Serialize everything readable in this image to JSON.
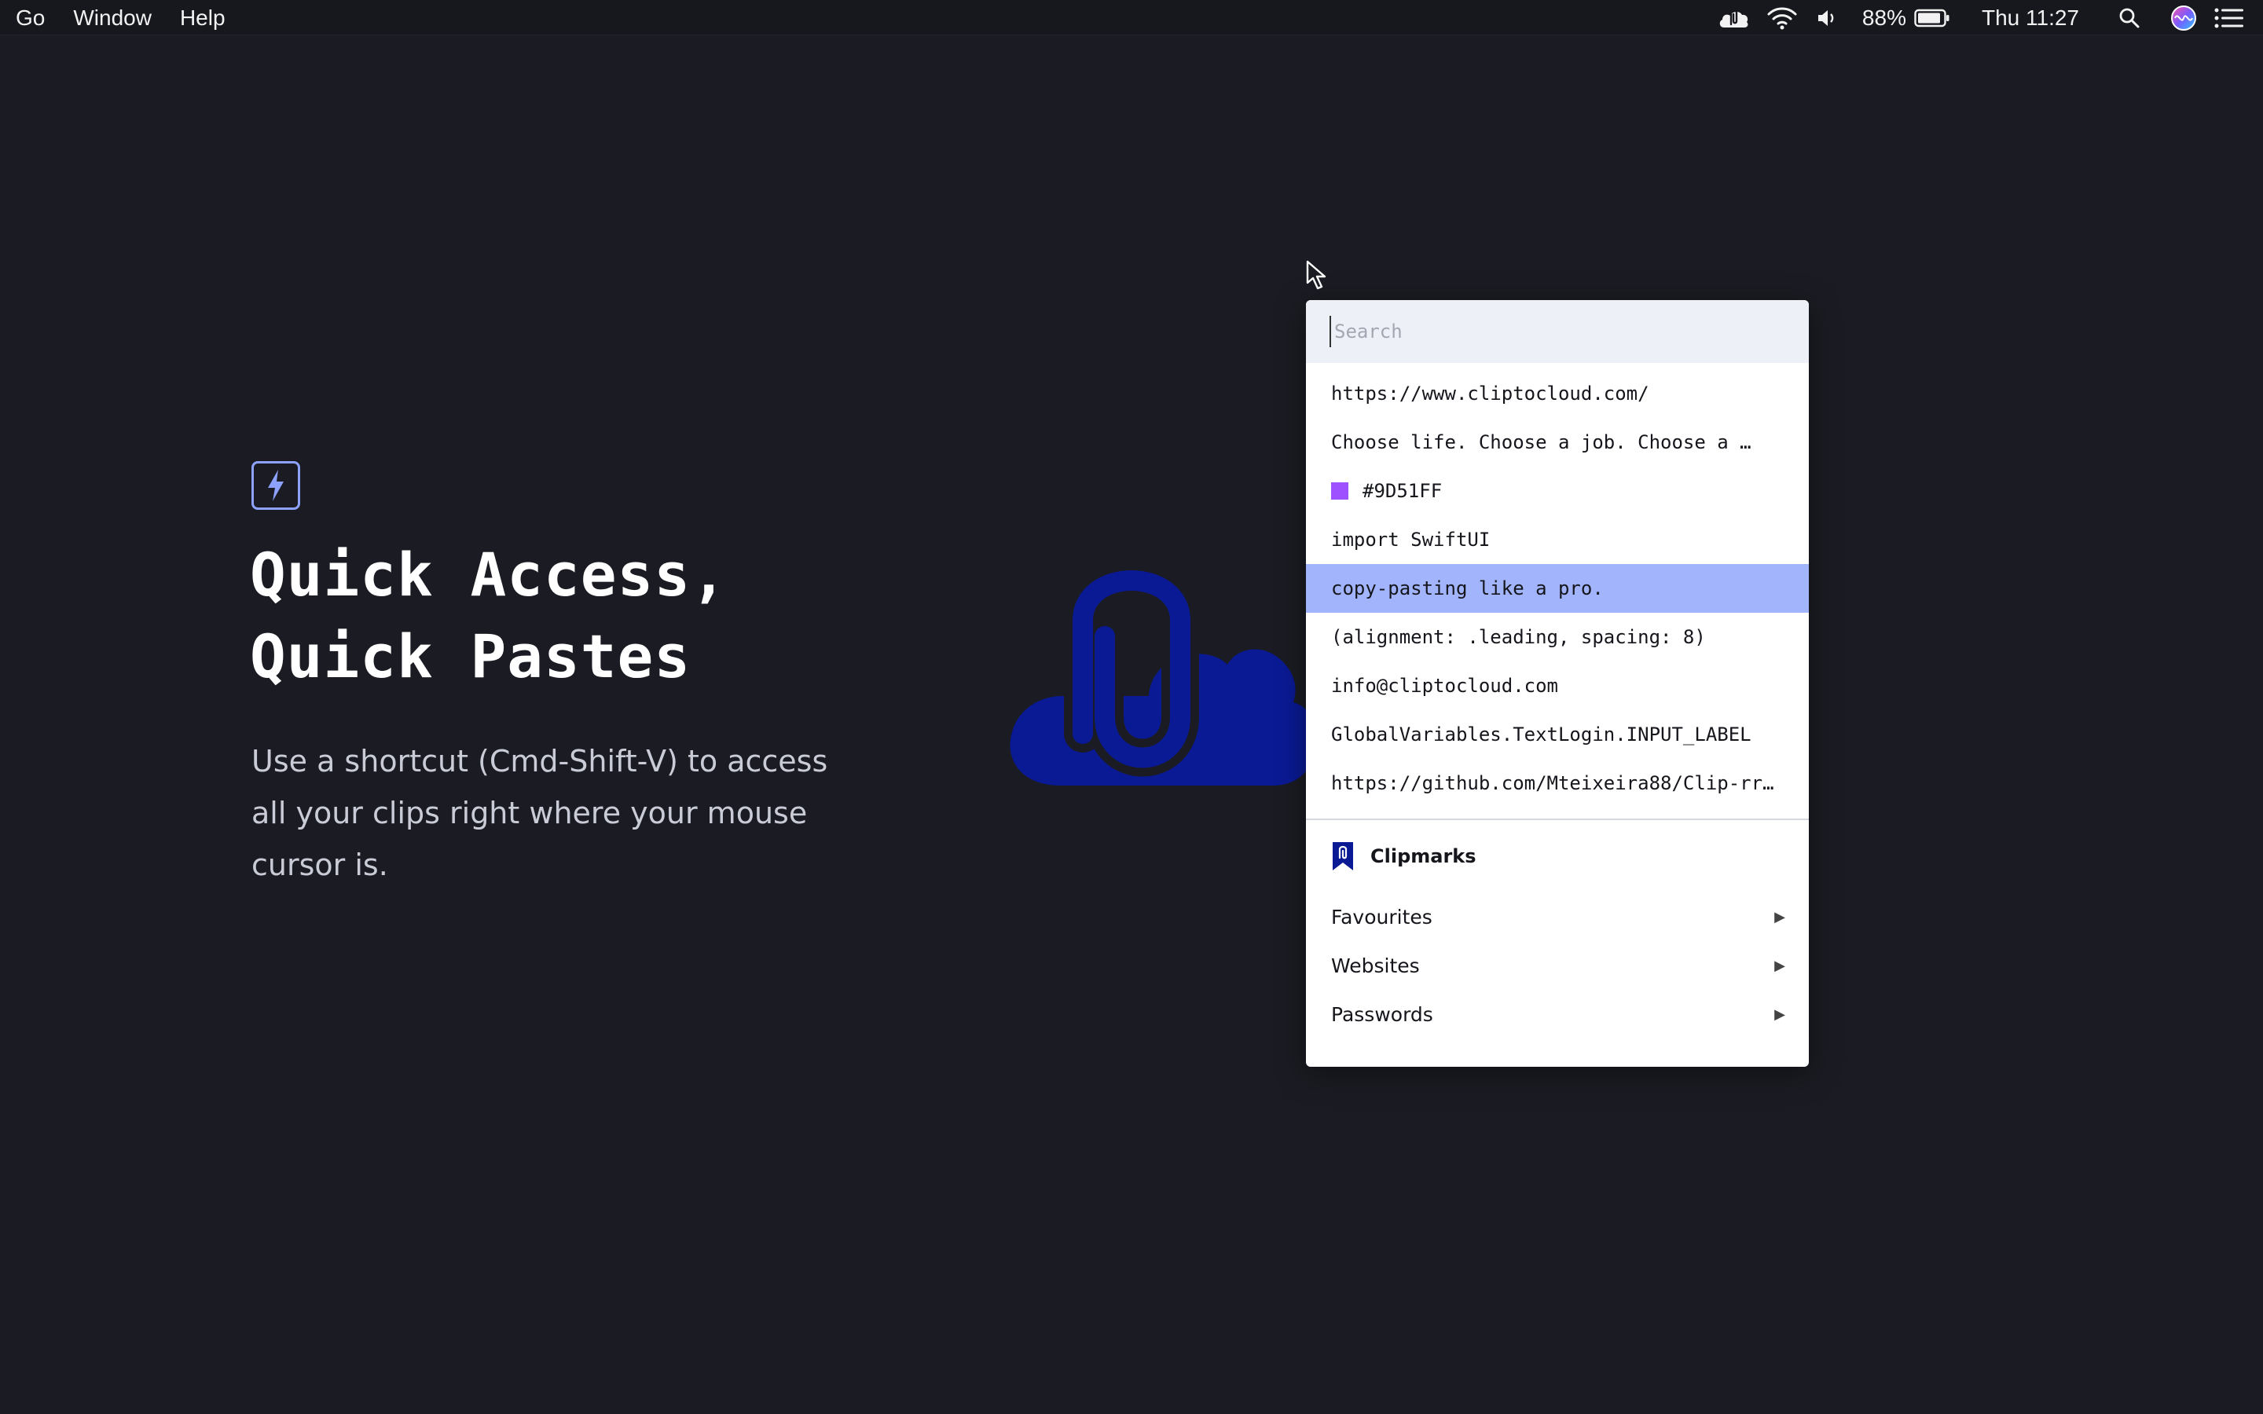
{
  "menubar": {
    "menus": [
      "Go",
      "Window",
      "Help"
    ],
    "battery_percent": "88%",
    "datetime": "Thu 11:27",
    "status_icons": [
      "cliptocloud-icon",
      "wifi-icon",
      "volume-icon",
      "battery-icon",
      "spotlight-search-icon",
      "siri-icon",
      "notification-center-icon"
    ]
  },
  "hero": {
    "title_line1": "Quick Access,",
    "title_line2": "Quick Pastes",
    "description": "Use a shortcut (Cmd-Shift-V) to access all your clips right where your mouse cursor is.",
    "badge_icon": "lightning-icon"
  },
  "popup": {
    "search": {
      "placeholder": "Search",
      "value": ""
    },
    "clips": [
      {
        "text": "https://www.cliptocloud.com/"
      },
      {
        "text": "Choose life. Choose a job. Choose a …"
      },
      {
        "text": "#9D51FF",
        "swatch": "#9D51FF"
      },
      {
        "text": "import SwiftUI"
      },
      {
        "text": "copy-pasting like a pro.",
        "selected": true
      },
      {
        "text": "(alignment: .leading, spacing: 8)"
      },
      {
        "text": "info@cliptocloud.com"
      },
      {
        "text": "GlobalVariables.TextLogin.INPUT_LABEL"
      },
      {
        "text": "https://github.com/Mteixeira88/Clip-rr…"
      }
    ],
    "clipmarks": {
      "title": "Clipmarks",
      "icon": "bookmark-icon",
      "folders": [
        {
          "label": "Favourites"
        },
        {
          "label": "Websites"
        },
        {
          "label": "Passwords"
        }
      ]
    }
  },
  "colors": {
    "background": "#1b1c23",
    "accent": "#8da2ff",
    "selection": "#a2b4fc",
    "logo_blue": "#0a1a94"
  }
}
